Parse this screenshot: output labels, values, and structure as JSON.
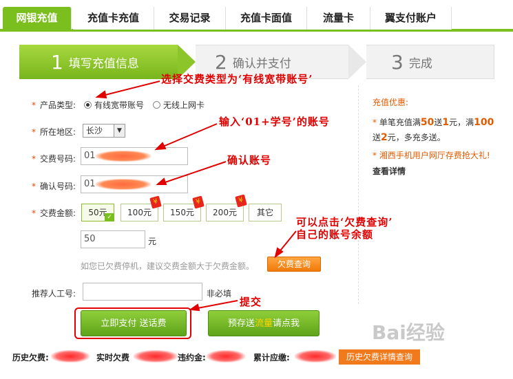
{
  "tabs": [
    "网银充值",
    "充值卡充值",
    "交易记录",
    "充值卡面值",
    "流量卡",
    "翼支付账户"
  ],
  "steps": [
    {
      "num": "1",
      "label": "填写充值信息"
    },
    {
      "num": "2",
      "label": "确认并支付"
    },
    {
      "num": "3",
      "label": "完成"
    }
  ],
  "form": {
    "product_type_label": "产品类型:",
    "product_options": [
      "有线宽带账号",
      "无线上网卡"
    ],
    "region_label": "所在地区:",
    "region_value": "长沙",
    "account_label": "交费号码:",
    "account_value_prefix": "01",
    "confirm_label": "确认号码:",
    "confirm_value_prefix": "01",
    "amount_label": "交费金额:",
    "amount_options": [
      "50元",
      "100元",
      "150元",
      "200元",
      "其它"
    ],
    "amount_value": "50",
    "amount_unit": "元",
    "stop_hint": "如您已欠费停机，建议交费金额大于欠费金额。",
    "arrears_query_button": "欠费查询",
    "referrer_label": "推荐人工号:",
    "referrer_hint": "非必填",
    "pay_button": "立即支付 送话费",
    "prestore_button_pre": "预存送",
    "prestore_button_hl": "流量",
    "prestore_button_post": "请点我"
  },
  "annotations": {
    "select_type": "选择交费类型为‘有线宽带账号’",
    "input_account": "输入‘01+学号’的账号",
    "confirm_account": "确认账号",
    "arrears_line1": "可以点击‘欠费查询’",
    "arrears_line2": "自己的账号余额",
    "submit": "提交"
  },
  "side": {
    "title": "充值优惠:",
    "offer_pre": "单笔充值满",
    "offer_50": "50",
    "offer_mid1": "送",
    "offer_1": "1",
    "offer_mid2": "元，满",
    "offer_100": "100",
    "offer_mid3": "送",
    "offer_2": "2",
    "offer_post": "元，多充多送。",
    "promo": "湘西手机用户网厅存费抢大礼!",
    "more": "查看详情"
  },
  "bottom": {
    "history_arrears": "历史欠费:",
    "realtime_arrears": "实时欠费",
    "penalty": "违约金:",
    "total_due": "累计应缴:",
    "detail_button": "历史欠费详情查询"
  },
  "watermark": "Bai经验",
  "colors": {
    "brand_green": "#7bbf1e",
    "accent_orange": "#f07a1c",
    "annotation_red": "#e00000"
  }
}
